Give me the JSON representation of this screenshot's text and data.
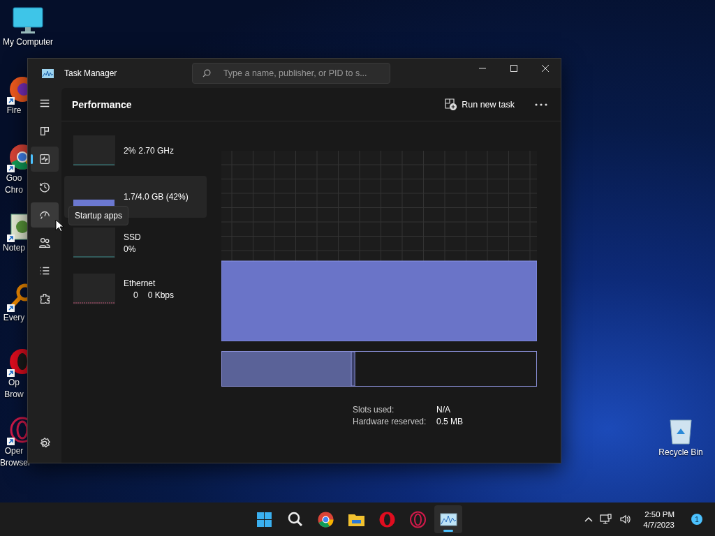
{
  "desktop_icons": [
    {
      "kind": "computer",
      "lines": [
        "My Computer"
      ]
    },
    {
      "kind": "firefox",
      "lines": [
        "Fire"
      ]
    },
    {
      "kind": "chrome",
      "lines": [
        "Goo",
        "Chro"
      ]
    },
    {
      "kind": "notepad",
      "lines": [
        "Notep"
      ]
    },
    {
      "kind": "search",
      "lines": [
        "Every"
      ]
    },
    {
      "kind": "opera",
      "lines": [
        "Op",
        "Brow"
      ]
    },
    {
      "kind": "operagx",
      "lines": [
        "Oper",
        "Browser"
      ]
    },
    {
      "kind": "recycle",
      "lines": [
        "Recycle Bin"
      ]
    }
  ],
  "window": {
    "title": "Task Manager",
    "search": {
      "placeholder": "Type a name, publisher, or PID to s..."
    },
    "nav": [
      {
        "kind": "menu",
        "selected": false,
        "hovered": false
      },
      {
        "kind": "processes",
        "selected": false,
        "hovered": false
      },
      {
        "kind": "performance",
        "selected": true,
        "hovered": false
      },
      {
        "kind": "history",
        "selected": false,
        "hovered": false
      },
      {
        "kind": "startup",
        "selected": false,
        "hovered": true
      },
      {
        "kind": "users",
        "selected": false,
        "hovered": false
      },
      {
        "kind": "details",
        "selected": false,
        "hovered": false
      },
      {
        "kind": "services",
        "selected": false,
        "hovered": false
      },
      {
        "kind": "settings",
        "selected": false,
        "hovered": false
      }
    ],
    "tooltip": "Startup apps",
    "page_title": "Performance",
    "run_new_task": "Run new task",
    "resources": [
      {
        "kind": "cpu",
        "values": [
          "2%",
          "2.70 GHz"
        ],
        "selected": false
      },
      {
        "kind": "memory",
        "values": [
          "1.7/4.0 GB (42%)"
        ],
        "selected": true
      },
      {
        "kind": "disk",
        "name": "SSD",
        "values": [
          "0%"
        ],
        "selected": false
      },
      {
        "kind": "network",
        "name": "Ethernet",
        "values": [
          "0",
          "0 Kbps"
        ],
        "selected": false
      }
    ],
    "details": [
      {
        "label": "Slots used:",
        "value": "N/A"
      },
      {
        "label": "Hardware reserved:",
        "value": "0.5 MB"
      }
    ]
  },
  "taskbar": {
    "apps": [
      {
        "kind": "start",
        "active": false
      },
      {
        "kind": "search",
        "active": false
      },
      {
        "kind": "chrome",
        "active": false
      },
      {
        "kind": "explorer",
        "active": false
      },
      {
        "kind": "opera",
        "active": false
      },
      {
        "kind": "operagx",
        "active": false
      },
      {
        "kind": "taskmanager",
        "active": true
      }
    ],
    "time": "2:50 PM",
    "date": "4/7/2023",
    "notifications": "1"
  }
}
